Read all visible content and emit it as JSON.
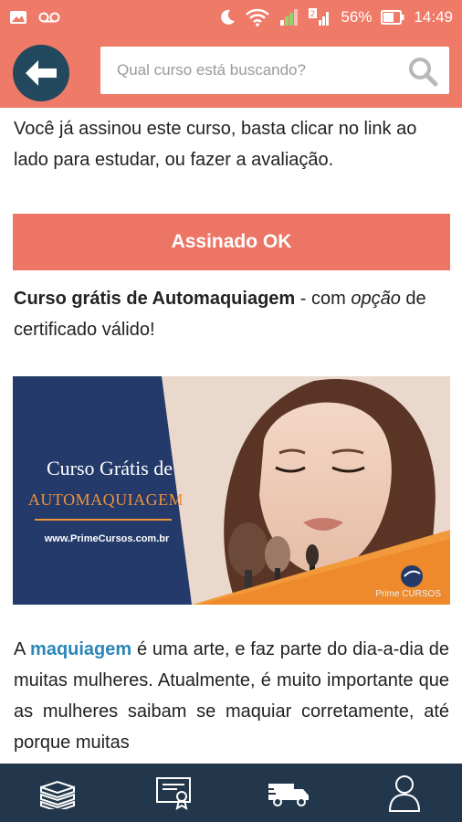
{
  "status_bar": {
    "battery_percent": "56%",
    "time": "14:49"
  },
  "header": {
    "back_icon": "arrow-left-icon",
    "search_placeholder": "Qual curso está buscando?",
    "search_icon": "search-icon"
  },
  "content": {
    "intro_text": "Você já assinou este curso, basta clicar no link ao lado para estudar, ou fazer a avaliação.",
    "subscribed_button_label": "Assinado OK",
    "course_title": "Curso grátis de Automaquiagem",
    "course_title_suffix": " - com ",
    "course_title_option": "opção",
    "course_title_end": " de certificado válido!",
    "banner": {
      "title_line1": "Curso Grátis de",
      "title_line2": "AUTOMAQUIAGEM",
      "url": "www.PrimeCursos.com.br",
      "logo_text": "Prime CURSOS"
    },
    "article_prefix": "A ",
    "article_link": "maquiagem",
    "article_rest": " é uma arte, e faz parte do dia-a-dia de muitas mulheres. Atualmente, é muito importante que as mulheres saibam se maquiar corretamente, até porque muitas"
  },
  "bottom_nav": {
    "items": [
      {
        "icon": "books-icon"
      },
      {
        "icon": "certificate-icon"
      },
      {
        "icon": "delivery-truck-icon"
      },
      {
        "icon": "user-icon"
      }
    ]
  },
  "colors": {
    "accent": "#f07a68",
    "button": "#ec7566",
    "dark_blue": "#22495e",
    "nav_bg": "#22374b",
    "link": "#2a86b8"
  }
}
